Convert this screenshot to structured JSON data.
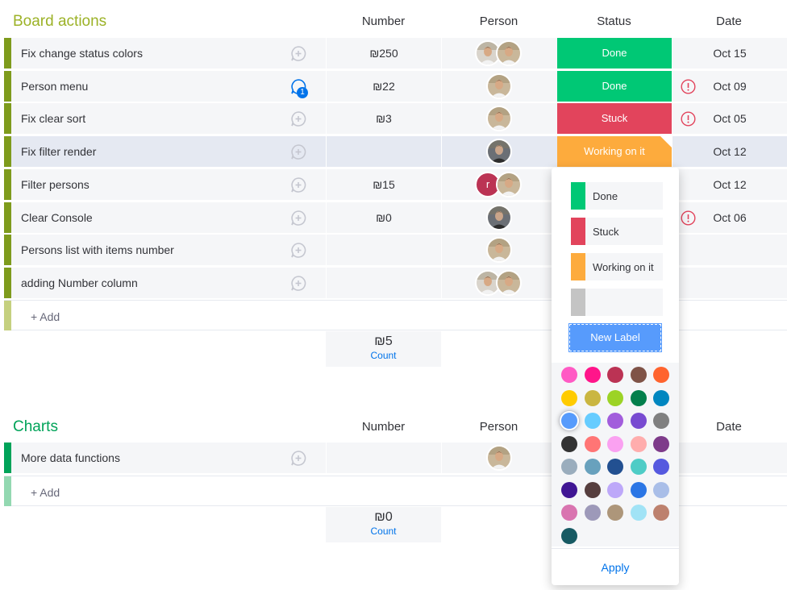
{
  "colors": {
    "group1": "#9cb227",
    "group1_bar": "#7e9b1c",
    "group2": "#00a359",
    "done": "#00c875",
    "stuck": "#e2445c",
    "working": "#fdab3d",
    "default": "#c4c4c4",
    "new_label": "#579bfc"
  },
  "groups": [
    {
      "title": "Board actions",
      "columns": {
        "number": "Number",
        "person": "Person",
        "status": "Status",
        "date": "Date"
      },
      "items": [
        {
          "name": "Fix change status colors",
          "chat_icon": "add-update-icon",
          "number": "₪250",
          "persons": 2,
          "status": "Done",
          "status_color": "#00c875",
          "alert": false,
          "date": "Oct 15"
        },
        {
          "name": "Person menu",
          "chat_icon": "update-bubble-icon",
          "chat_count": "1",
          "number": "₪22",
          "persons": 1,
          "status": "Done",
          "status_color": "#00c875",
          "alert": true,
          "date": "Oct 09"
        },
        {
          "name": "Fix clear sort",
          "chat_icon": "add-update-icon",
          "number": "₪3",
          "persons": 1,
          "status": "Stuck",
          "status_color": "#e2445c",
          "alert": true,
          "date": "Oct 05"
        },
        {
          "name": "Fix filter render",
          "chat_icon": "add-update-icon",
          "number": "",
          "persons": 1,
          "status": "Working on it",
          "status_color": "#fdab3d",
          "alert": false,
          "date": "Oct 12"
        },
        {
          "name": "Filter persons",
          "chat_icon": "add-update-icon",
          "number": "₪15",
          "persons": 2,
          "avatar_initial": "r",
          "status": "",
          "alert": false,
          "date": "Oct 12"
        },
        {
          "name": "Clear Console",
          "chat_icon": "add-update-icon",
          "number": "₪0",
          "persons": 1,
          "status": "",
          "alert": true,
          "date": "Oct 06"
        },
        {
          "name": "Persons list with items number",
          "chat_icon": "add-update-icon",
          "number": "",
          "persons": 1,
          "status": "",
          "alert": false,
          "date": ""
        },
        {
          "name": "adding Number column",
          "chat_icon": "add-update-icon",
          "number": "",
          "persons": 2,
          "status": "",
          "alert": false,
          "date": ""
        }
      ],
      "add_label": "+ Add",
      "summary": {
        "value": "₪5",
        "label": "Count"
      }
    },
    {
      "title": "Charts",
      "columns": {
        "number": "Number",
        "person": "Person",
        "date": "Date"
      },
      "items": [
        {
          "name": "More data functions",
          "chat_icon": "add-update-icon",
          "number": "",
          "persons": 1,
          "status": "",
          "alert": false,
          "date": ""
        }
      ],
      "add_label": "+ Add",
      "summary": {
        "value": "₪0",
        "label": "Count"
      }
    }
  ],
  "status_menu": {
    "labels": [
      {
        "text": "Done",
        "color": "#00c875"
      },
      {
        "text": "Stuck",
        "color": "#e2445c"
      },
      {
        "text": "Working on it",
        "color": "#fdab3d"
      },
      {
        "text": "",
        "color": "#c4c4c4"
      }
    ],
    "new_label": "New Label",
    "palette": [
      "#ff5ac4",
      "#ff158a",
      "#bb3354",
      "#7f5347",
      "#ff642e",
      "#ffcb00",
      "#cab641",
      "#9cd326",
      "#037f4c",
      "#0086c0",
      "#579bfc",
      "#66ccff",
      "#a25ddc",
      "#784bd1",
      "#808080",
      "#333333",
      "#ff7575",
      "#faa1f1",
      "#ffadad",
      "#7e3b8a",
      "#9aadbd",
      "#68a1bd",
      "#225091",
      "#4eccc6",
      "#5559df",
      "#401694",
      "#563e3e",
      "#bda8f9",
      "#2b76e5",
      "#a9bee8",
      "#d974b0",
      "#9d99b9",
      "#ad967a",
      "#a1e3f6",
      "#bd816e",
      "#175a63"
    ],
    "selected_index": 10,
    "apply": "Apply"
  }
}
